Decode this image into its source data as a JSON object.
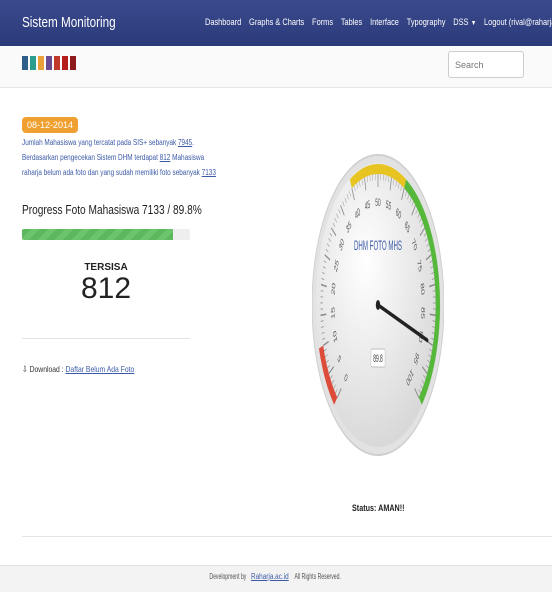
{
  "app": {
    "title": "Sistem Monitoring"
  },
  "nav": {
    "items": [
      "Dashboard",
      "Graphs & Charts",
      "Forms",
      "Tables",
      "Interface",
      "Typography",
      "DSS",
      "Logout (rival@raharja.info)"
    ]
  },
  "search": {
    "placeholder": "Search"
  },
  "info": {
    "date": "08-12-2014",
    "t1": "Jumlah Mahasiswa yang tercatat pada SIS+ sebanyak ",
    "total": "7945",
    "t2": ". Berdasarkan pengecekan Sistem DHM terdapat ",
    "missing": "812",
    "t3": " Mahasiswa raharja belum ada foto dan yang sudah memiliki foto sebanyak ",
    "have": "7133"
  },
  "progress": {
    "title": "Progress Foto Mahasiswa 7133 / 89.8%",
    "percent": 89.8
  },
  "remaining": {
    "label": "TERSISA",
    "value": "812"
  },
  "download": {
    "label": "Download :",
    "link": "Daftar Belum Ada Foto"
  },
  "gauge": {
    "title": "DHM FOTO MHS",
    "value": 89.8,
    "display": "89.8",
    "min": 0,
    "max": 100,
    "ticks": [
      "0",
      "5",
      "10",
      "15",
      "20",
      "25",
      "30",
      "35",
      "40",
      "45",
      "50",
      "55",
      "60",
      "65",
      "70",
      "75",
      "80",
      "85",
      "90",
      "95",
      "100"
    ],
    "bands": [
      {
        "from": 0,
        "to": 10,
        "color": "#dd4b39"
      },
      {
        "from": 40,
        "to": 60,
        "color": "#e8c422"
      },
      {
        "from": 60,
        "to": 100,
        "color": "#55b83a"
      }
    ]
  },
  "status": {
    "text": "Status: AMAN!!"
  },
  "footer": {
    "prefix": "Development by ",
    "link": "Raharja.ac.id",
    "suffix": " All Rights Reserved."
  },
  "logo_colors": [
    "#2d5f8a",
    "#2a9d8f",
    "#e9a23b",
    "#6a4c93",
    "#c0392b",
    "#b71c1c",
    "#8e1b1b"
  ]
}
